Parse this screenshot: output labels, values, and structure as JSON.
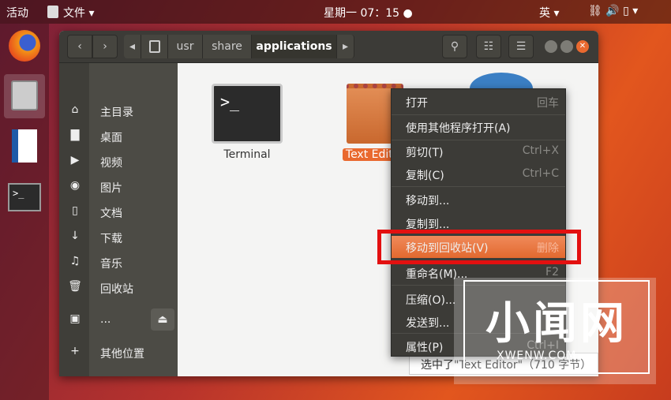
{
  "topbar": {
    "activities": "活动",
    "app_menu": "文件 ▾",
    "clock": "星期一 07：15 ●",
    "input_method": "英 ▾",
    "status_icons": "⛓ 🔊 ▯ ▾"
  },
  "dock": {
    "apps": [
      "firefox",
      "files",
      "libreoffice-writer",
      "terminal"
    ]
  },
  "header": {
    "back": "‹",
    "forward": "›",
    "crumb_left": "◂",
    "crumb_right": "▸",
    "path": [
      "usr",
      "share",
      "applications"
    ],
    "search_icon": "search-icon",
    "view_icon": "list-view-icon",
    "menu_icon": "hamburger-icon"
  },
  "sidebar": {
    "items": [
      {
        "icon": "⌂",
        "label": "主目录"
      },
      {
        "icon": "▇",
        "label": "桌面"
      },
      {
        "icon": "▶",
        "label": "视频"
      },
      {
        "icon": "◉",
        "label": "图片"
      },
      {
        "icon": "▯",
        "label": "文档"
      },
      {
        "icon": "↓",
        "label": "下载"
      },
      {
        "icon": "♫",
        "label": "音乐"
      },
      {
        "icon": "🗑",
        "label": "回收站"
      },
      {
        "icon": "▣",
        "label": "..."
      },
      {
        "icon": "+",
        "label": "其他位置"
      }
    ],
    "eject": "⏏"
  },
  "files": [
    {
      "name": "Terminal"
    },
    {
      "name": "Text Editor",
      "selected": true
    }
  ],
  "context_menu": {
    "items": [
      {
        "label": "打开",
        "shortcut": "回车"
      },
      {
        "label": "使用其他程序打开(A)",
        "shortcut": ""
      },
      {
        "label": "剪切(T)",
        "shortcut": "Ctrl+X"
      },
      {
        "label": "复制(C)",
        "shortcut": "Ctrl+C"
      },
      {
        "label": "移动到...",
        "shortcut": ""
      },
      {
        "label": "复制到...",
        "shortcut": ""
      },
      {
        "label": "移动到回收站(V)",
        "shortcut": "删除",
        "highlighted": true
      },
      {
        "label": "重命名(M)...",
        "shortcut": "F2"
      },
      {
        "label": "压缩(O)...",
        "shortcut": ""
      },
      {
        "label": "发送到...",
        "shortcut": ""
      },
      {
        "label": "属性(P)",
        "shortcut": "Ctrl+I"
      }
    ]
  },
  "status": "选中了\"Text Editor\"（710 字节）",
  "watermark": {
    "title": "小闻网",
    "url": "XWENW.COM"
  },
  "colors": {
    "accent": "#e9692f",
    "highlight_box": "#e31010",
    "header": "#3c3b37"
  }
}
